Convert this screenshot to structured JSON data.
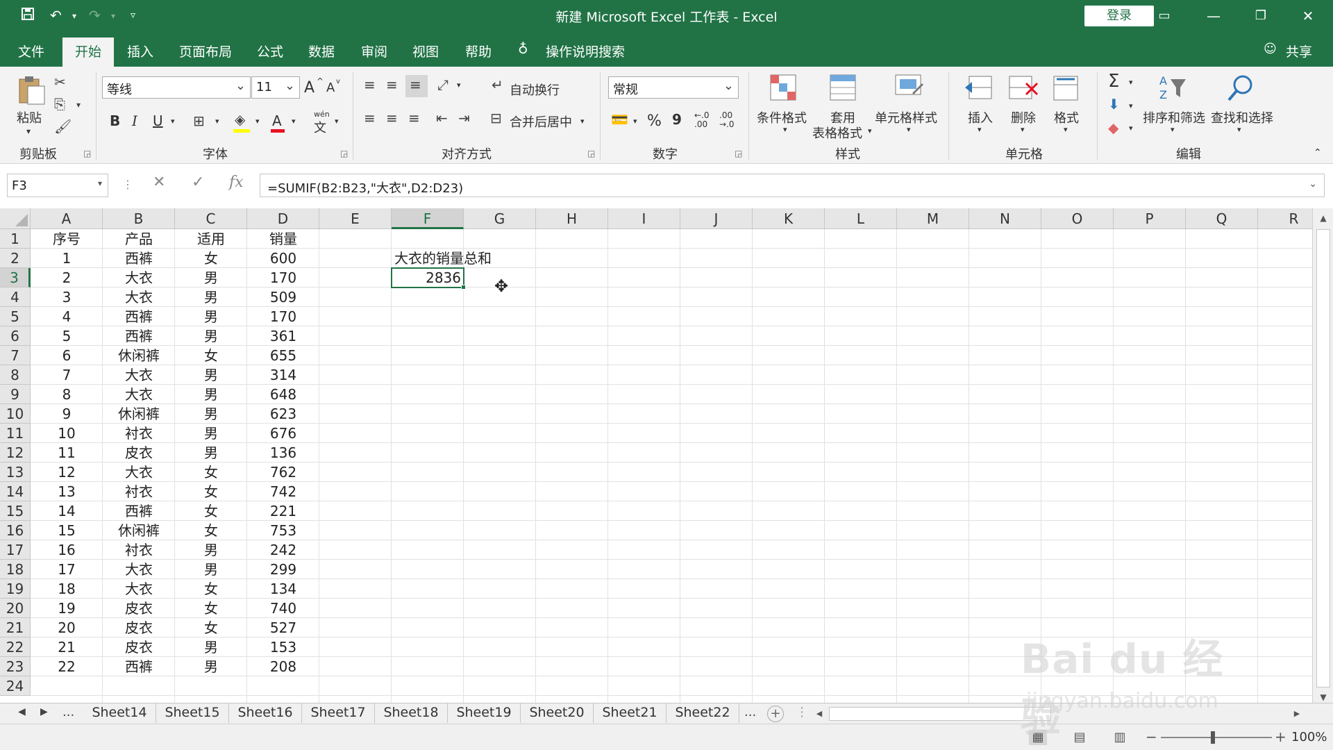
{
  "window": {
    "title": "新建 Microsoft Excel 工作表  -  Excel",
    "login_label": "登录",
    "qa_save_icon": "save-icon",
    "qa_undo_icon": "undo-icon",
    "qa_redo_icon": "redo-icon",
    "qa_customize_icon": "customize-icon"
  },
  "tabs": [
    {
      "label": "文件"
    },
    {
      "label": "开始"
    },
    {
      "label": "插入"
    },
    {
      "label": "页面布局"
    },
    {
      "label": "公式"
    },
    {
      "label": "数据"
    },
    {
      "label": "审阅"
    },
    {
      "label": "视图"
    },
    {
      "label": "帮助"
    }
  ],
  "tell_me": "操作说明搜索",
  "share_label": "共享",
  "ribbon": {
    "clipboard": {
      "paste_label": "粘贴",
      "group_label": "剪贴板"
    },
    "font": {
      "font_name": "等线",
      "font_size": "11",
      "bold": "B",
      "italic": "I",
      "underline": "U",
      "grow": "A",
      "shrink": "A",
      "font_color": "A",
      "phonetic": "wén",
      "phonetic_char": "文",
      "group_label": "字体"
    },
    "alignment": {
      "wrap_label": "自动换行",
      "merge_label": "合并后居中",
      "group_label": "对齐方式"
    },
    "number": {
      "format": "常规",
      "percent": "%",
      "comma": "9",
      "inc_decimal": "←.0 .00",
      "dec_decimal": ".00 →.0",
      "group_label": "数字"
    },
    "styles": {
      "cond_label": "条件格式",
      "table_label_1": "套用",
      "table_label_2": "表格格式",
      "cell_style_label": "单元格样式",
      "group_label": "样式"
    },
    "cells": {
      "insert_label": "插入",
      "delete_label": "删除",
      "format_label": "格式",
      "group_label": "单元格"
    },
    "editing": {
      "sort_label": "排序和筛选",
      "find_label": "查找和选择",
      "group_label": "编辑"
    }
  },
  "formula_bar": {
    "name_box": "F3",
    "formula": "=SUMIF(B2:B23,\"大衣\",D2:D23)",
    "fx": "fx",
    "cancel": "✕",
    "enter": "✓"
  },
  "columns": [
    "A",
    "B",
    "C",
    "D",
    "E",
    "F",
    "G",
    "H",
    "I",
    "J",
    "K",
    "L",
    "M",
    "N",
    "O",
    "P",
    "Q",
    "R"
  ],
  "rows": [
    "1",
    "2",
    "3",
    "4",
    "5",
    "6",
    "7",
    "8",
    "9",
    "10",
    "11",
    "12",
    "13",
    "14",
    "15",
    "16",
    "17",
    "18",
    "19",
    "20",
    "21",
    "22",
    "23",
    "24"
  ],
  "table": {
    "headers": [
      "序号",
      "产品",
      "适用",
      "销量"
    ],
    "rows": [
      [
        "1",
        "西裤",
        "女",
        "600"
      ],
      [
        "2",
        "大衣",
        "男",
        "170"
      ],
      [
        "3",
        "大衣",
        "男",
        "509"
      ],
      [
        "4",
        "西裤",
        "男",
        "170"
      ],
      [
        "5",
        "西裤",
        "男",
        "361"
      ],
      [
        "6",
        "休闲裤",
        "女",
        "655"
      ],
      [
        "7",
        "大衣",
        "男",
        "314"
      ],
      [
        "8",
        "大衣",
        "男",
        "648"
      ],
      [
        "9",
        "休闲裤",
        "男",
        "623"
      ],
      [
        "10",
        "衬衣",
        "男",
        "676"
      ],
      [
        "11",
        "皮衣",
        "男",
        "136"
      ],
      [
        "12",
        "大衣",
        "女",
        "762"
      ],
      [
        "13",
        "衬衣",
        "女",
        "742"
      ],
      [
        "14",
        "西裤",
        "女",
        "221"
      ],
      [
        "15",
        "休闲裤",
        "女",
        "753"
      ],
      [
        "16",
        "衬衣",
        "男",
        "242"
      ],
      [
        "17",
        "大衣",
        "男",
        "299"
      ],
      [
        "18",
        "大衣",
        "女",
        "134"
      ],
      [
        "19",
        "皮衣",
        "女",
        "740"
      ],
      [
        "20",
        "皮衣",
        "女",
        "527"
      ],
      [
        "21",
        "皮衣",
        "男",
        "153"
      ],
      [
        "22",
        "西裤",
        "男",
        "208"
      ]
    ]
  },
  "summary": {
    "label": "大衣的销量总和",
    "value": "2836"
  },
  "selected_cell": "F3",
  "sheets": [
    "Sheet14",
    "Sheet15",
    "Sheet16",
    "Sheet17",
    "Sheet18",
    "Sheet19",
    "Sheet20",
    "Sheet21",
    "Sheet22"
  ],
  "sheet_nav": {
    "prev": "◀",
    "next": "▶",
    "more": "...",
    "more_right": "...",
    "add": "+"
  },
  "status": {
    "zoom": "100%",
    "zoom_minus": "−",
    "zoom_plus": "+"
  },
  "watermark": {
    "main": "Bai du 经验",
    "sub": "jingyan.baidu.com"
  },
  "colors": {
    "accent": "#217346",
    "ribbon_bg": "#f3f3f3",
    "grid_line": "#e1e1e1"
  }
}
